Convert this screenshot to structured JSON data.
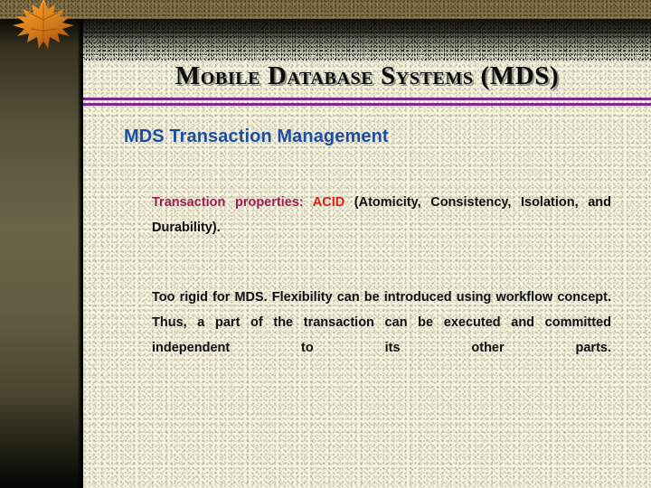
{
  "slide": {
    "title": "Mobile Database Systems (MDS)",
    "headline": "MDS Transaction Management",
    "paragraphs": [
      {
        "id": "transaction-properties",
        "runs": [
          {
            "text": "Transaction  properties:  ",
            "color": "#9e1f52"
          },
          {
            "text": "ACID ",
            "color": "#e01b10"
          },
          {
            "text": " (Atomicity, Consistency, Isolation, and Durability).",
            "color": "#101010"
          }
        ]
      },
      {
        "id": "workflow-flexibility",
        "runs": [
          {
            "text": "Too rigid for MDS.  Flexibility can be introduced using workflow concept.  Thus, a part of the transaction can be executed and committed independent to its other parts.",
            "color": "#101010"
          }
        ]
      }
    ]
  },
  "decoration": {
    "leaf_icon": "maple-leaf-icon",
    "leaf_colors": [
      "#e8901f",
      "#d4761a",
      "#b8600f",
      "#f0aa36"
    ],
    "top_strip_color": "#7d6e44",
    "sidebar_gradient": [
      "#0a0a06",
      "#6a6549",
      "#060604"
    ],
    "rule_color": "#7b2a8c",
    "header_band_color": "#100e08",
    "page_background": "#f5f2de",
    "title_color": "#0b0b0b",
    "headline_color": "#1d4ea3"
  }
}
